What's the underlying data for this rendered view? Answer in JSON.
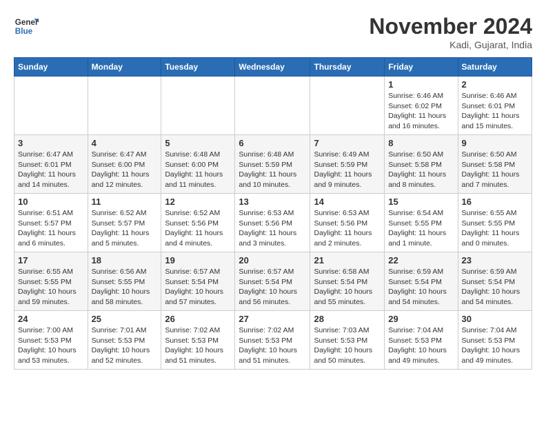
{
  "logo": {
    "line1": "General",
    "line2": "Blue"
  },
  "title": "November 2024",
  "location": "Kadi, Gujarat, India",
  "days_of_week": [
    "Sunday",
    "Monday",
    "Tuesday",
    "Wednesday",
    "Thursday",
    "Friday",
    "Saturday"
  ],
  "weeks": [
    [
      {
        "day": "",
        "info": ""
      },
      {
        "day": "",
        "info": ""
      },
      {
        "day": "",
        "info": ""
      },
      {
        "day": "",
        "info": ""
      },
      {
        "day": "",
        "info": ""
      },
      {
        "day": "1",
        "info": "Sunrise: 6:46 AM\nSunset: 6:02 PM\nDaylight: 11 hours and 16 minutes."
      },
      {
        "day": "2",
        "info": "Sunrise: 6:46 AM\nSunset: 6:01 PM\nDaylight: 11 hours and 15 minutes."
      }
    ],
    [
      {
        "day": "3",
        "info": "Sunrise: 6:47 AM\nSunset: 6:01 PM\nDaylight: 11 hours and 14 minutes."
      },
      {
        "day": "4",
        "info": "Sunrise: 6:47 AM\nSunset: 6:00 PM\nDaylight: 11 hours and 12 minutes."
      },
      {
        "day": "5",
        "info": "Sunrise: 6:48 AM\nSunset: 6:00 PM\nDaylight: 11 hours and 11 minutes."
      },
      {
        "day": "6",
        "info": "Sunrise: 6:48 AM\nSunset: 5:59 PM\nDaylight: 11 hours and 10 minutes."
      },
      {
        "day": "7",
        "info": "Sunrise: 6:49 AM\nSunset: 5:59 PM\nDaylight: 11 hours and 9 minutes."
      },
      {
        "day": "8",
        "info": "Sunrise: 6:50 AM\nSunset: 5:58 PM\nDaylight: 11 hours and 8 minutes."
      },
      {
        "day": "9",
        "info": "Sunrise: 6:50 AM\nSunset: 5:58 PM\nDaylight: 11 hours and 7 minutes."
      }
    ],
    [
      {
        "day": "10",
        "info": "Sunrise: 6:51 AM\nSunset: 5:57 PM\nDaylight: 11 hours and 6 minutes."
      },
      {
        "day": "11",
        "info": "Sunrise: 6:52 AM\nSunset: 5:57 PM\nDaylight: 11 hours and 5 minutes."
      },
      {
        "day": "12",
        "info": "Sunrise: 6:52 AM\nSunset: 5:56 PM\nDaylight: 11 hours and 4 minutes."
      },
      {
        "day": "13",
        "info": "Sunrise: 6:53 AM\nSunset: 5:56 PM\nDaylight: 11 hours and 3 minutes."
      },
      {
        "day": "14",
        "info": "Sunrise: 6:53 AM\nSunset: 5:56 PM\nDaylight: 11 hours and 2 minutes."
      },
      {
        "day": "15",
        "info": "Sunrise: 6:54 AM\nSunset: 5:55 PM\nDaylight: 11 hours and 1 minute."
      },
      {
        "day": "16",
        "info": "Sunrise: 6:55 AM\nSunset: 5:55 PM\nDaylight: 11 hours and 0 minutes."
      }
    ],
    [
      {
        "day": "17",
        "info": "Sunrise: 6:55 AM\nSunset: 5:55 PM\nDaylight: 10 hours and 59 minutes."
      },
      {
        "day": "18",
        "info": "Sunrise: 6:56 AM\nSunset: 5:55 PM\nDaylight: 10 hours and 58 minutes."
      },
      {
        "day": "19",
        "info": "Sunrise: 6:57 AM\nSunset: 5:54 PM\nDaylight: 10 hours and 57 minutes."
      },
      {
        "day": "20",
        "info": "Sunrise: 6:57 AM\nSunset: 5:54 PM\nDaylight: 10 hours and 56 minutes."
      },
      {
        "day": "21",
        "info": "Sunrise: 6:58 AM\nSunset: 5:54 PM\nDaylight: 10 hours and 55 minutes."
      },
      {
        "day": "22",
        "info": "Sunrise: 6:59 AM\nSunset: 5:54 PM\nDaylight: 10 hours and 54 minutes."
      },
      {
        "day": "23",
        "info": "Sunrise: 6:59 AM\nSunset: 5:54 PM\nDaylight: 10 hours and 54 minutes."
      }
    ],
    [
      {
        "day": "24",
        "info": "Sunrise: 7:00 AM\nSunset: 5:53 PM\nDaylight: 10 hours and 53 minutes."
      },
      {
        "day": "25",
        "info": "Sunrise: 7:01 AM\nSunset: 5:53 PM\nDaylight: 10 hours and 52 minutes."
      },
      {
        "day": "26",
        "info": "Sunrise: 7:02 AM\nSunset: 5:53 PM\nDaylight: 10 hours and 51 minutes."
      },
      {
        "day": "27",
        "info": "Sunrise: 7:02 AM\nSunset: 5:53 PM\nDaylight: 10 hours and 51 minutes."
      },
      {
        "day": "28",
        "info": "Sunrise: 7:03 AM\nSunset: 5:53 PM\nDaylight: 10 hours and 50 minutes."
      },
      {
        "day": "29",
        "info": "Sunrise: 7:04 AM\nSunset: 5:53 PM\nDaylight: 10 hours and 49 minutes."
      },
      {
        "day": "30",
        "info": "Sunrise: 7:04 AM\nSunset: 5:53 PM\nDaylight: 10 hours and 49 minutes."
      }
    ]
  ]
}
